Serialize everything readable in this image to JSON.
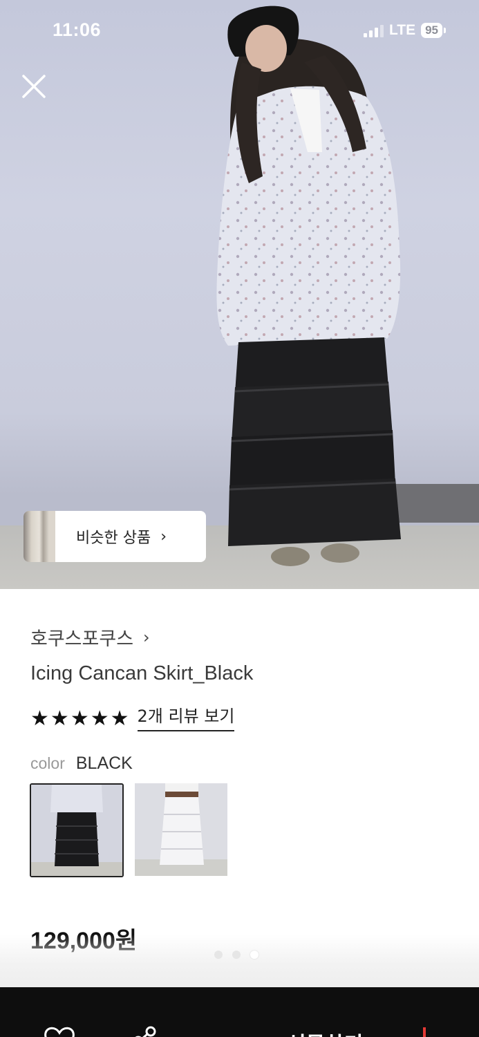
{
  "status_bar": {
    "time": "11:06",
    "network": "LTE",
    "battery": "95"
  },
  "hero": {
    "similar_products_label": "비슷한 상품",
    "similar_products_arrow": "›"
  },
  "product": {
    "brand": "호쿠스포쿠스",
    "brand_chevron": "›",
    "title": "Icing Cancan Skirt_Black",
    "rating": 5,
    "review_link": "2개 리뷰 보기",
    "color_label": "color",
    "color_value": "BLACK",
    "color_options": [
      "black-skirt-thumbnail",
      "white-skirt-thumbnail"
    ],
    "price": "129,000원"
  },
  "carousel": {
    "total": 3,
    "active_index": 2
  },
  "bottom_bar": {
    "gift_label": "선물하기",
    "icons": [
      "heart-icon",
      "share-icon"
    ]
  },
  "colors": {
    "accent_red": "#e53935",
    "bottom_bar_bg": "#0e0e0e"
  }
}
